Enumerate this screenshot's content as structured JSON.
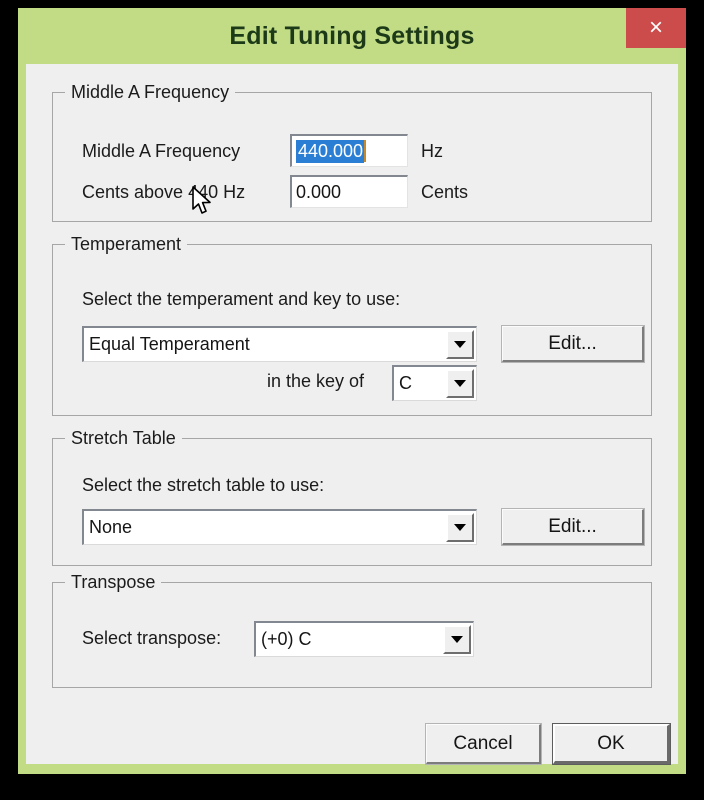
{
  "window": {
    "title": "Edit Tuning Settings",
    "close_label": "×",
    "frame_color": "#c2dc86",
    "titlebar_text_color": "#1c3a18",
    "close_button_color": "#cc4b4b",
    "client_bg": "#efeff0",
    "selection_color": "#2a7fd4",
    "caret_color": "#c8892c"
  },
  "middle_a_group": {
    "title": "Middle A Frequency",
    "frequency_label": "Middle A Frequency",
    "frequency_value": "440.000",
    "frequency_unit": "Hz",
    "cents_label": "Cents above 440 Hz",
    "cents_value": "0.000",
    "cents_unit": "Cents"
  },
  "temperament_group": {
    "title": "Temperament",
    "instruction": "Select the temperament and key to use:",
    "temperament_value": "Equal Temperament",
    "edit_label": "Edit...",
    "key_label": "in the key of",
    "key_value": "C"
  },
  "stretch_group": {
    "title": "Stretch Table",
    "instruction": "Select the stretch table to use:",
    "stretch_value": "None",
    "edit_label": "Edit..."
  },
  "transpose_group": {
    "title": "Transpose",
    "transpose_label": "Select transpose:",
    "transpose_value": "(+0) C"
  },
  "footer": {
    "cancel_label": "Cancel",
    "ok_label": "OK"
  },
  "icons": {
    "close": "close-icon",
    "dropdown": "chevron-down-icon",
    "cursor": "mouse-pointer-icon"
  }
}
